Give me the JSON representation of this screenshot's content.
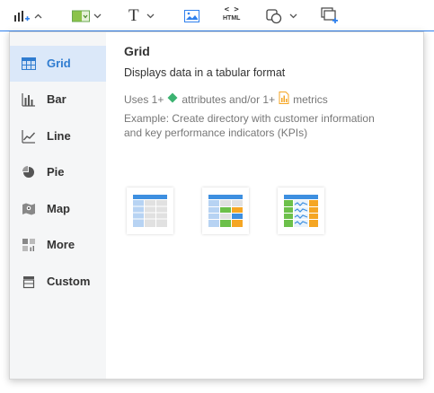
{
  "toolbar": {
    "items": [
      {
        "name": "insert-visualization",
        "icon": "bar-chart-plus-icon"
      },
      {
        "name": "insert-filter",
        "icon": "filter-box-icon"
      },
      {
        "name": "insert-text",
        "icon": "text-T-icon",
        "glyph": "T"
      },
      {
        "name": "insert-image",
        "icon": "image-icon"
      },
      {
        "name": "insert-html",
        "icon": "html-code-icon",
        "label": "HTML",
        "code": "< >"
      },
      {
        "name": "insert-shape",
        "icon": "shapes-icon"
      },
      {
        "name": "insert-panel",
        "icon": "panel-stack-plus-icon"
      }
    ],
    "accent": "#2f80ed"
  },
  "sidebar": {
    "items": [
      {
        "label": "Grid",
        "icon": "grid-icon",
        "active": true
      },
      {
        "label": "Bar",
        "icon": "bar-chart-icon",
        "active": false
      },
      {
        "label": "Line",
        "icon": "line-chart-icon",
        "active": false
      },
      {
        "label": "Pie",
        "icon": "pie-chart-icon",
        "active": false
      },
      {
        "label": "Map",
        "icon": "map-icon",
        "active": false
      },
      {
        "label": "More",
        "icon": "more-charts-icon",
        "active": false
      },
      {
        "label": "Custom",
        "icon": "custom-visualization-icon",
        "active": false
      }
    ]
  },
  "content": {
    "title": "Grid",
    "description": "Displays data in a tabular format",
    "uses_prefix": "Uses 1+",
    "uses_attr": "attributes and/or 1+",
    "uses_metrics": "metrics",
    "example": "Example: Create directory with customer information and key performance indicators (KPIs)",
    "thumbnails": [
      {
        "name": "grid-thumbnail",
        "icon": "simple-grid-icon"
      },
      {
        "name": "heatmap-grid-thumbnail",
        "icon": "colored-grid-icon"
      },
      {
        "name": "microchart-grid-thumbnail",
        "icon": "sparkline-grid-icon"
      }
    ]
  },
  "colors": {
    "active_bg": "#dbe8f9",
    "active_text": "#2f7cd0",
    "attribute": "#3cb371",
    "metric": "#f5a623"
  }
}
